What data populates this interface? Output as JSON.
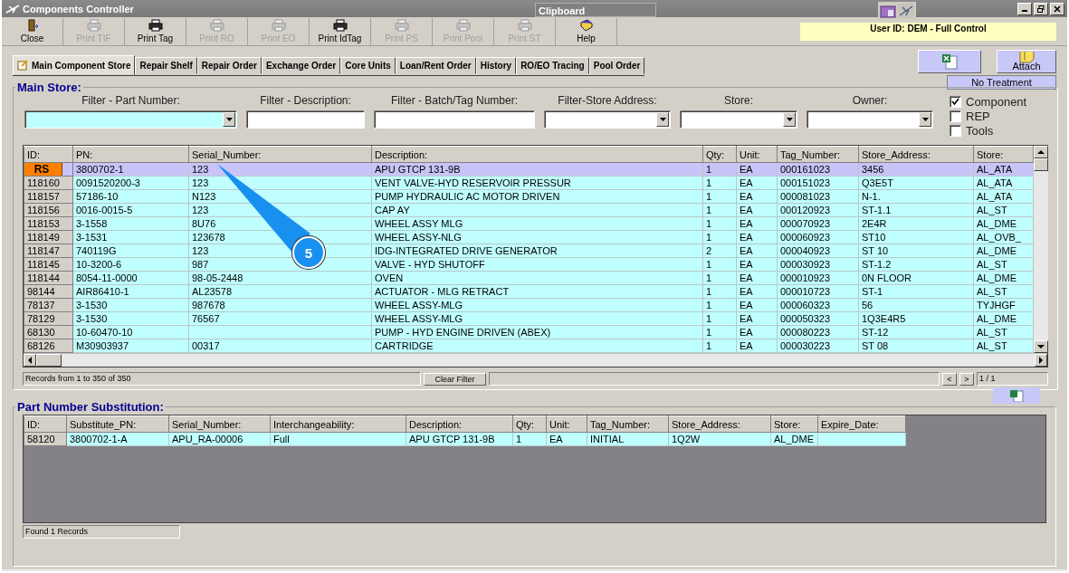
{
  "window": {
    "title": "Components Controller"
  },
  "clipboard": {
    "title": "Clipboard"
  },
  "toolbar": [
    {
      "label": "Close",
      "kind": "close",
      "disabled": false
    },
    {
      "label": "Print TIF",
      "kind": "print",
      "disabled": true
    },
    {
      "label": "Print Tag",
      "kind": "print",
      "disabled": false
    },
    {
      "label": "Print RO",
      "kind": "print",
      "disabled": true
    },
    {
      "label": "Print EO",
      "kind": "print",
      "disabled": true
    },
    {
      "label": "Print IdTag",
      "kind": "print",
      "disabled": false
    },
    {
      "label": "Print PS",
      "kind": "print",
      "disabled": true
    },
    {
      "label": "Print Pool",
      "kind": "print",
      "disabled": true
    },
    {
      "label": "Print ST",
      "kind": "print",
      "disabled": true
    },
    {
      "label": "Help",
      "kind": "help",
      "disabled": false
    }
  ],
  "user_info": "User ID: DEM - Full Control",
  "tabs": [
    {
      "label": "Main Component Store",
      "selected": true
    },
    {
      "label": "Repair Shelf",
      "selected": false
    },
    {
      "label": "Repair Order",
      "selected": false
    },
    {
      "label": "Exchange Order",
      "selected": false
    },
    {
      "label": "Core Units",
      "selected": false
    },
    {
      "label": "Loan/Rent Order",
      "selected": false
    },
    {
      "label": "History",
      "selected": false
    },
    {
      "label": "RO/EO Tracing",
      "selected": false
    },
    {
      "label": "Pool Order",
      "selected": false
    }
  ],
  "attach_button": {
    "label": "Attach"
  },
  "treatment": "No Treatment",
  "main_store": {
    "title": "Main Store:",
    "filters": [
      {
        "label": "Filter - Part Number:",
        "kind": "combo",
        "focused": true
      },
      {
        "label": "Filter - Description:",
        "kind": "text",
        "focused": false
      },
      {
        "label": "Filter - Batch/Tag Number:",
        "kind": "text",
        "focused": false
      },
      {
        "label": "Filter-Store Address:",
        "kind": "combo",
        "focused": false
      },
      {
        "label": "Store:",
        "kind": "combo",
        "focused": false
      },
      {
        "label": "Owner:",
        "kind": "combo",
        "focused": false
      }
    ],
    "checkboxes": [
      {
        "label": "Component",
        "checked": true
      },
      {
        "label": "REP",
        "checked": false
      },
      {
        "label": "Tools",
        "checked": false
      }
    ],
    "table": {
      "columns": [
        "ID:",
        "PN:",
        "Serial_Number:",
        "Description:",
        "Qty:",
        "Unit:",
        "Tag_Number:",
        "Store_Address:",
        "Store:"
      ],
      "rows": [
        {
          "badge": true,
          "cells": [
            "RS",
            "3800702-1",
            "123",
            "APU GTCP 131-9B",
            "1",
            "EA",
            "000161023",
            "3456",
            "AL_ATA"
          ],
          "selected": true
        },
        {
          "badge": false,
          "cells": [
            "118160",
            "0091520200-3",
            "123",
            "VENT VALVE-HYD RESERVOIR PRESSUR",
            "1",
            "EA",
            "000151023",
            "Q3E5T",
            "AL_ATA"
          ],
          "selected": false
        },
        {
          "badge": false,
          "cells": [
            "118157",
            "57186-10",
            "N123",
            "PUMP HYDRAULIC AC MOTOR DRIVEN",
            "1",
            "EA",
            "000081023",
            "N-1.",
            "AL_ATA"
          ],
          "selected": false
        },
        {
          "badge": false,
          "cells": [
            "118156",
            "0016-0015-5",
            "123",
            "CAP AY",
            "1",
            "EA",
            "000120923",
            "ST-1.1",
            "AL_ST"
          ],
          "selected": false
        },
        {
          "badge": false,
          "cells": [
            "118153",
            "3-1558",
            "8U76",
            "WHEEL ASSY MLG",
            "1",
            "EA",
            "000070923",
            "2E4R",
            "AL_DME"
          ],
          "selected": false
        },
        {
          "badge": false,
          "cells": [
            "118149",
            "3-1531",
            "123678",
            "WHEEL ASSY-NLG",
            "1",
            "EA",
            "000060923",
            "ST10",
            "AL_OVB_"
          ],
          "selected": false
        },
        {
          "badge": false,
          "cells": [
            "118147",
            "740119G",
            "123",
            "IDG-INTEGRATED DRIVE GENERATOR",
            "2",
            "EA",
            "000040923",
            "ST 10",
            "AL_DME"
          ],
          "selected": false
        },
        {
          "badge": false,
          "cells": [
            "118145",
            "10-3200-6",
            "987",
            "VALVE - HYD SHUTOFF",
            "1",
            "EA",
            "000030923",
            "ST-1.2",
            "AL_ST"
          ],
          "selected": false
        },
        {
          "badge": false,
          "cells": [
            "118144",
            "8054-11-0000",
            "98-05-2448",
            "OVEN",
            "1",
            "EA",
            "000010923",
            "0N FLOOR",
            "AL_DME"
          ],
          "selected": false
        },
        {
          "badge": false,
          "cells": [
            "98144",
            "AIR86410-1",
            "AL23578",
            "ACTUATOR - MLG RETRACT",
            "1",
            "EA",
            "000010723",
            "ST-1",
            "AL_ST"
          ],
          "selected": false
        },
        {
          "badge": false,
          "cells": [
            "78137",
            "3-1530",
            "987678",
            "WHEEL ASSY-MLG",
            "1",
            "EA",
            "000060323",
            "56",
            "TYJHGF"
          ],
          "selected": false
        },
        {
          "badge": false,
          "cells": [
            "78129",
            "3-1530",
            "76567",
            "WHEEL ASSY-MLG",
            "1",
            "EA",
            "000050323",
            "1Q3E4R5",
            "AL_DME"
          ],
          "selected": false
        },
        {
          "badge": false,
          "cells": [
            "68130",
            "10-60470-10",
            "",
            "PUMP - HYD ENGINE DRIVEN (ABEX)",
            "1",
            "EA",
            "000080223",
            "ST-12",
            "AL_ST"
          ],
          "selected": false
        },
        {
          "badge": false,
          "cells": [
            "68126",
            "M30903937",
            "00317",
            "CARTRIDGE",
            "1",
            "EA",
            "000030223",
            "ST 08",
            "AL_ST"
          ],
          "selected": false
        }
      ]
    },
    "status": "Records from 1 to 350 of 350",
    "clear_filter": "Clear Filter",
    "prev": "<",
    "next": ">",
    "page": "1 / 1"
  },
  "callout": "5",
  "substitution": {
    "title": "Part Number Substitution:",
    "table": {
      "columns": [
        "ID:",
        "Substitute_PN:",
        "Serial_Number:",
        "Interchangeability:",
        "Description:",
        "Qty:",
        "Unit:",
        "Tag_Number:",
        "Store_Address:",
        "Store:",
        "Expire_Date:"
      ],
      "rows": [
        {
          "cells": [
            "58120",
            "3800702-1-A",
            "APU_RA-00006",
            "Full",
            "APU GTCP 131-9B",
            "1",
            "EA",
            "INITIAL",
            "1Q2W",
            "AL_DME",
            ""
          ],
          "selected": false
        }
      ]
    },
    "status": "Found 1 Records"
  }
}
